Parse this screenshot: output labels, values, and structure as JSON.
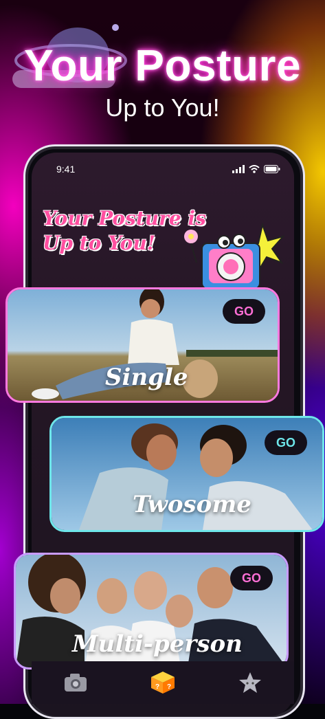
{
  "hero": {
    "title": "Your Posture",
    "subtitle": "Up to You!"
  },
  "status_bar": {
    "time": "9:41"
  },
  "promo": {
    "line1": "Your Posture is",
    "line2": "Up to You!"
  },
  "cards": [
    {
      "label": "Single",
      "go_label": "GO",
      "border_color": "#ff7ae0"
    },
    {
      "label": "Twosome",
      "go_label": "GO",
      "border_color": "#6ee6ea"
    },
    {
      "label": "Multi-person",
      "go_label": "GO",
      "border_color": "#c99bff"
    }
  ],
  "tabbar": {
    "items": [
      {
        "icon": "camera-icon"
      },
      {
        "icon": "mystery-box-icon"
      },
      {
        "icon": "star-icon"
      }
    ]
  },
  "colors": {
    "accent_pink": "#ff4fa0",
    "neon_glow": "#ff2bd6",
    "go_text": "#ff6fd6"
  }
}
